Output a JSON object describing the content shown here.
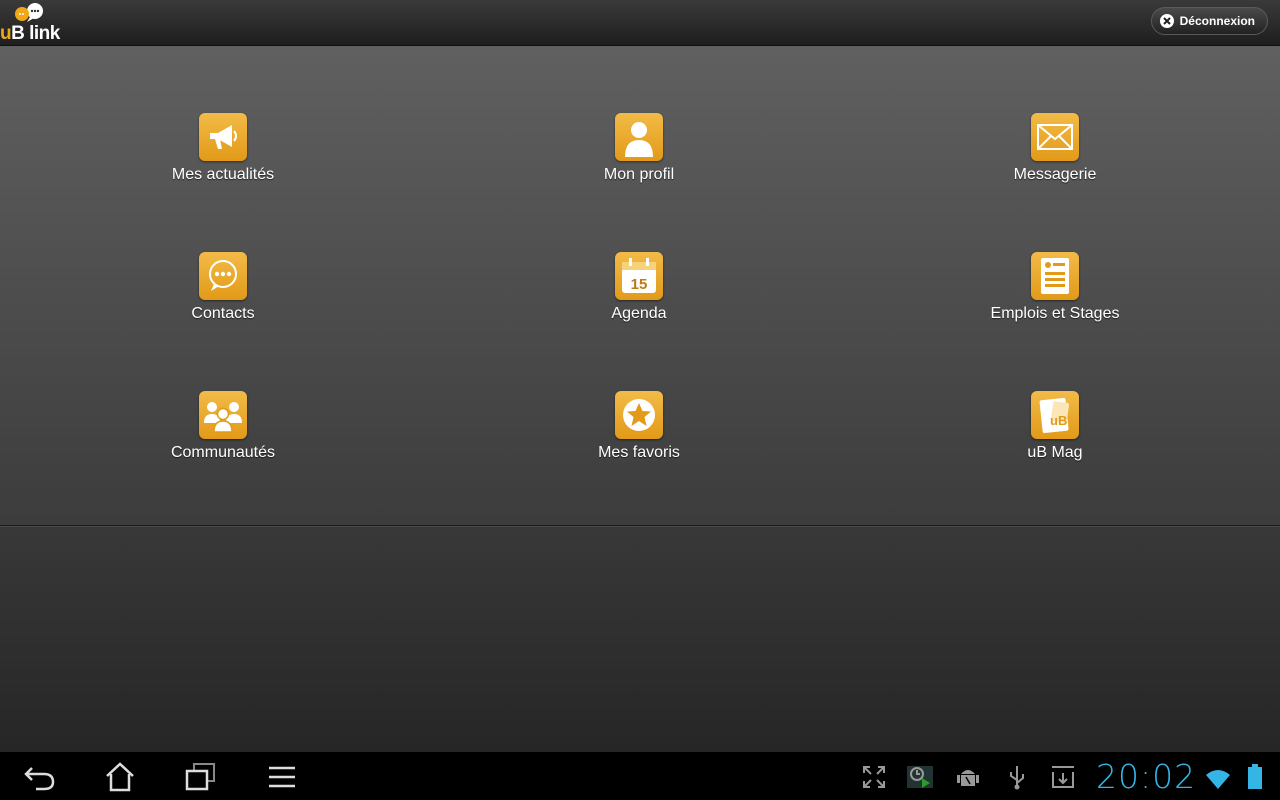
{
  "header": {
    "logo_text_u": "u",
    "logo_text_rest": "B link",
    "logout_label": "Déconnexion"
  },
  "menu": [
    {
      "label": "Mes actualités",
      "icon": "megaphone-icon"
    },
    {
      "label": "Mon profil",
      "icon": "person-icon"
    },
    {
      "label": "Messagerie",
      "icon": "envelope-icon"
    },
    {
      "label": "Contacts",
      "icon": "chat-bubble-icon"
    },
    {
      "label": "Agenda",
      "icon": "calendar-icon",
      "icon_text": "15"
    },
    {
      "label": "Emplois et Stages",
      "icon": "resume-icon"
    },
    {
      "label": "Communautés",
      "icon": "group-icon"
    },
    {
      "label": "Mes favoris",
      "icon": "star-icon"
    },
    {
      "label": "uB Mag",
      "icon": "magazine-icon"
    }
  ],
  "status_bar": {
    "clock": "20:02"
  },
  "colors": {
    "accent": "#f0a818",
    "clock": "#33b5e5"
  }
}
